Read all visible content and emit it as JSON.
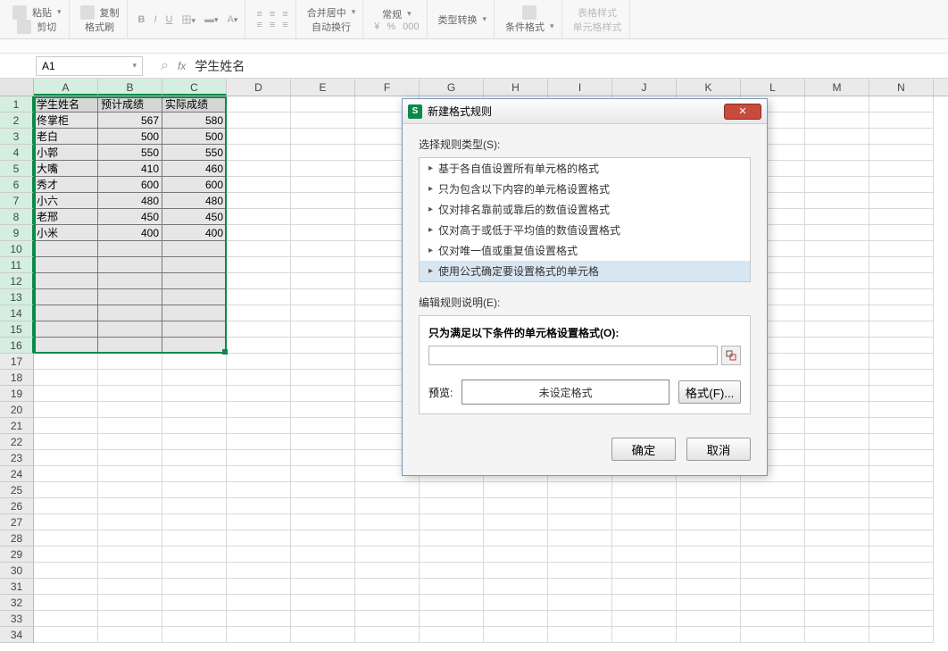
{
  "toolbar": {
    "paste": "粘贴",
    "copy": "复制",
    "format_painter": "格式刷",
    "merge_center": "合并居中",
    "auto_wrap": "自动换行",
    "general": "常规",
    "type_convert": "类型转换",
    "cond_format": "条件格式",
    "cell_style": "单元格样式",
    "table_style": "表格样式",
    "cut": "剪切"
  },
  "namebox": "A1",
  "formula": "学生姓名",
  "columns": [
    "A",
    "B",
    "C",
    "D",
    "E",
    "F",
    "G",
    "H",
    "I",
    "J",
    "K",
    "L",
    "M",
    "N"
  ],
  "table": {
    "headers": [
      "学生姓名",
      "预计成绩",
      "实际成绩"
    ],
    "rows": [
      [
        "佟掌柜",
        "567",
        "580"
      ],
      [
        "老白",
        "500",
        "500"
      ],
      [
        "小郭",
        "550",
        "550"
      ],
      [
        "大嘴",
        "410",
        "460"
      ],
      [
        "秀才",
        "600",
        "600"
      ],
      [
        "小六",
        "480",
        "480"
      ],
      [
        "老邢",
        "450",
        "450"
      ],
      [
        "小米",
        "400",
        "400"
      ]
    ]
  },
  "dialog": {
    "title": "新建格式规则",
    "select_rule_label": "选择规则类型(S):",
    "rules": [
      "基于各自值设置所有单元格的格式",
      "只为包含以下内容的单元格设置格式",
      "仅对排名靠前或靠后的数值设置格式",
      "仅对高于或低于平均值的数值设置格式",
      "仅对唯一值或重复值设置格式",
      "使用公式确定要设置格式的单元格"
    ],
    "selected_rule": 5,
    "edit_label": "编辑规则说明(E):",
    "condition_label": "只为满足以下条件的单元格设置格式(O):",
    "preview_label": "预览:",
    "preview_text": "未设定格式",
    "format_btn": "格式(F)...",
    "ok": "确定",
    "cancel": "取消"
  },
  "row_count": 34,
  "sel_rows": 16
}
